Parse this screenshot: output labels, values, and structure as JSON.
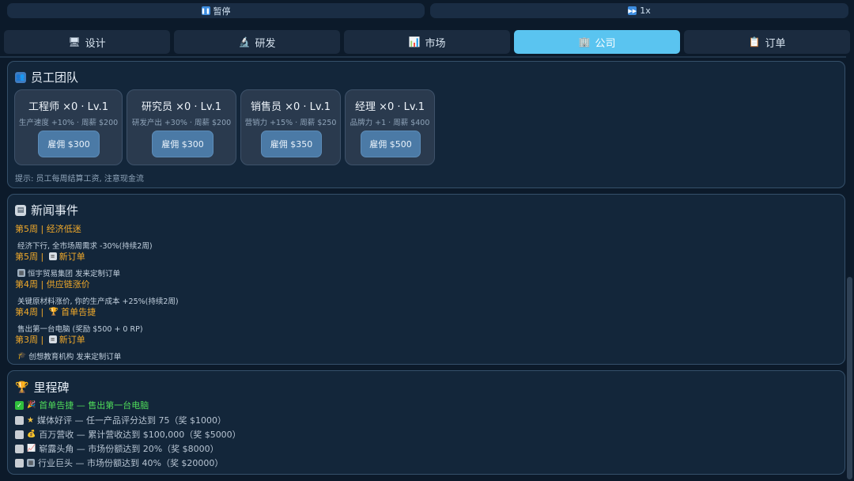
{
  "controls": {
    "pause_label": "暂停",
    "speed_label": "1x"
  },
  "tabs": [
    {
      "label": "设计",
      "icon": "monitor-icon",
      "active": false
    },
    {
      "label": "研发",
      "icon": "microscope-icon",
      "active": false
    },
    {
      "label": "市场",
      "icon": "bar-chart-icon",
      "active": false
    },
    {
      "label": "公司",
      "icon": "office-icon",
      "active": true
    },
    {
      "label": "订单",
      "icon": "clipboard-icon",
      "active": false
    }
  ],
  "team": {
    "title": "员工团队",
    "employees": [
      {
        "name": "工程师 ×0 · Lv.1",
        "desc": "生产速度 +10% · 周薪 $200",
        "hire_label": "雇佣 $300"
      },
      {
        "name": "研究员 ×0 · Lv.1",
        "desc": "研发产出 +30% · 周薪 $200",
        "hire_label": "雇佣 $300"
      },
      {
        "name": "销售员 ×0 · Lv.1",
        "desc": "营销力 +15% · 周薪 $250",
        "hire_label": "雇佣 $350"
      },
      {
        "name": "经理 ×0 · Lv.1",
        "desc": "品牌力 +1 · 周薪 $400",
        "hire_label": "雇佣 $500"
      }
    ],
    "tip": "提示: 员工每周结算工资, 注意现金流"
  },
  "news": {
    "title": "新闻事件",
    "items": [
      {
        "head": "第5周 | 经济低迷",
        "head_icon": "",
        "body": "经济下行, 全市场周需求 -30%(持续2周)",
        "body_icon": ""
      },
      {
        "head_prefix": "第5周 | ",
        "head": "新订单",
        "head_icon": "clipboard-icon",
        "body": "恒宇贸易集团 发来定制订单",
        "body_icon": "office-icon"
      },
      {
        "head": "第4周 | 供应链涨价",
        "head_icon": "",
        "body": "关键原材料涨价, 你的生产成本 +25%(持续2周)",
        "body_icon": ""
      },
      {
        "head_prefix": "第4周 | ",
        "head": "首单告捷",
        "head_icon": "trophy-icon",
        "body": "售出第一台电脑 (奖励 $500 + 0 RP)",
        "body_icon": ""
      },
      {
        "head_prefix": "第3周 | ",
        "head": "新订单",
        "head_icon": "clipboard-icon",
        "body": "创想教育机构 发来定制订单",
        "body_icon": "graduation-cap-icon"
      }
    ]
  },
  "milestones": {
    "title": "里程碑",
    "items": [
      {
        "text": "首单告捷 — 售出第一台电脑",
        "done": true,
        "icon": "party-popper-icon"
      },
      {
        "text": "媒体好评 — 任一产品评分达到 75（奖 $1000）",
        "done": false,
        "icon": "star-icon"
      },
      {
        "text": "百万营收 — 累计营收达到 $100,000（奖 $5000）",
        "done": false,
        "icon": "money-bag-icon"
      },
      {
        "text": "崭露头角 — 市场份额达到 20%（奖 $8000）",
        "done": false,
        "icon": "trending-up-icon"
      },
      {
        "text": "行业巨头 — 市场份额达到 40%（奖 $20000）",
        "done": false,
        "icon": "office-icon"
      }
    ]
  },
  "colors": {
    "background": "#0c1a2a",
    "panel": "#13263a",
    "active_tab": "#5ac4f0",
    "news_headline": "#f0a92a",
    "milestone_done": "#4fdc5a"
  }
}
